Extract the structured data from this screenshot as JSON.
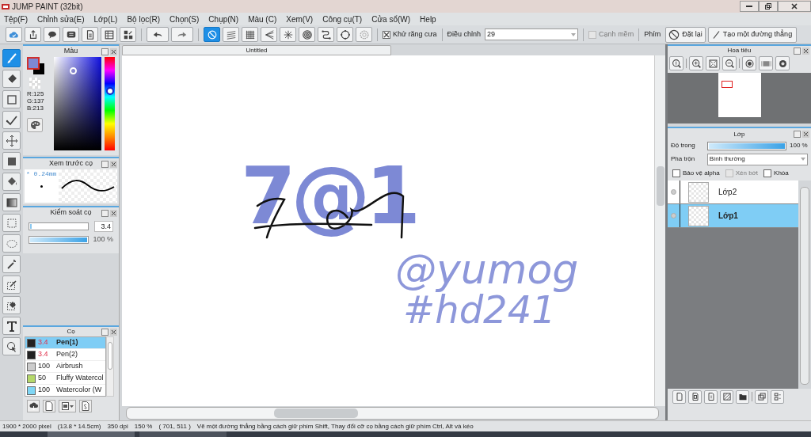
{
  "window": {
    "title": "JUMP PAINT (32bit)"
  },
  "menu": [
    "Tệp(F)",
    "Chỉnh sửa(E)",
    "Lớp(L)",
    "Bộ lọc(R)",
    "Chọn(S)",
    "Chụp(N)",
    "Màu (C)",
    "Xem(V)",
    "Công cụ(T)",
    "Cửa sổ(W)",
    "Help"
  ],
  "toolbar": {
    "file_buttons": [
      {
        "kind": "cloud"
      },
      {
        "kind": "share"
      },
      {
        "kind": "chat"
      },
      {
        "kind": "comment"
      },
      {
        "kind": "page"
      },
      {
        "kind": "sheet"
      },
      {
        "kind": "tiles"
      }
    ],
    "history_buttons": [
      {
        "kind": "undo"
      },
      {
        "kind": "redo"
      }
    ],
    "ruler_buttons": [
      {
        "kind": "none",
        "selected": true
      },
      {
        "kind": "parallel",
        "selected": false
      },
      {
        "kind": "grid",
        "selected": false
      },
      {
        "kind": "perspective",
        "selected": false
      },
      {
        "kind": "radial",
        "selected": false
      },
      {
        "kind": "concentric",
        "selected": false
      },
      {
        "kind": "curve",
        "selected": false
      },
      {
        "kind": "ellipse",
        "selected": false
      },
      {
        "kind": "gear",
        "selected": false
      }
    ],
    "antialias": {
      "label": "Khử răng cưa",
      "checked": true
    },
    "adjust": {
      "label": "Điều chỉnh",
      "value": "29"
    },
    "soft_edge": {
      "label": "Cạnh mềm",
      "checked": false,
      "disabled": true
    },
    "key_label": "Phím",
    "reset_button": "Đặt lại",
    "line_button": "Tạo một đường thẳng"
  },
  "tools": [
    {
      "kind": "brush",
      "selected": true
    },
    {
      "kind": "eraser",
      "selected": false
    },
    {
      "kind": "rect",
      "selected": false
    },
    {
      "kind": "dotline",
      "selected": false
    },
    {
      "kind": "move",
      "selected": false
    },
    {
      "kind": "fill",
      "selected": false
    },
    {
      "kind": "bucket",
      "selected": false
    },
    {
      "kind": "gradient",
      "selected": false
    },
    {
      "kind": "select",
      "selected": false
    },
    {
      "kind": "lasso",
      "selected": false
    },
    {
      "kind": "wand",
      "selected": false
    },
    {
      "kind": "selpen",
      "selected": false
    },
    {
      "kind": "selerase",
      "selected": false
    },
    {
      "kind": "text",
      "selected": false
    },
    {
      "kind": "pointer",
      "selected": false
    }
  ],
  "color_panel": {
    "title": "Màu",
    "readout": [
      "R:125",
      "G:137",
      "B:213"
    ]
  },
  "brush_preview": {
    "title": "Xem trước cọ",
    "size": "* 0.24mm"
  },
  "brush_control": {
    "title": "Kiểm soát cọ",
    "size_level": {
      "level": 0.03
    },
    "size_value": "3.4",
    "opacity": {
      "level": 1
    },
    "opacity_value": "100 %"
  },
  "brushes": {
    "title": "Cọ",
    "items": [
      {
        "color": "#222222",
        "size": "3.4",
        "size_alert": true,
        "name": "Pen(1)",
        "selected": true
      },
      {
        "color": "#222222",
        "size": "3.4",
        "size_alert": true,
        "name": "Pen(2)",
        "selected": false
      },
      {
        "color": "#cccccc",
        "size": "100",
        "size_alert": false,
        "name": "Airbrush",
        "selected": false
      },
      {
        "color": "#b5d86a",
        "size": "50",
        "size_alert": false,
        "name": "Fluffy Watercol",
        "selected": false
      },
      {
        "color": "#7fd6f5",
        "size": "100",
        "size_alert": false,
        "name": "Watercolor (W",
        "selected": false
      }
    ]
  },
  "document": {
    "tab": "Untitled",
    "artwork": [
      "7@1",
      "@yumog",
      "#hd241"
    ]
  },
  "navigator": {
    "title": "Hoa tiêu"
  },
  "layers": {
    "title": "Lớp",
    "opacity_label": "Độ trong",
    "opacity": {
      "level": 1
    },
    "opacity_value": "100 %",
    "blend_label": "Pha trộn",
    "blend": "Bình thường",
    "options": [
      {
        "label": "Bảo vệ alpha",
        "checked": false,
        "disabled": false
      },
      {
        "label": "Xén bớt",
        "checked": false,
        "disabled": true
      },
      {
        "label": "Khóa",
        "checked": false,
        "disabled": false
      }
    ],
    "items": [
      {
        "name": "Lớp2",
        "selected": false
      },
      {
        "name": "Lớp1",
        "selected": true
      }
    ]
  },
  "status_bar": [
    "1900 * 2000 pixel",
    "(13.8 * 14.5cm)",
    "350 dpi",
    "150 %",
    "( 701, 511 )",
    "Vẽ một đường thẳng bằng cách giữ phím Shift, Thay đổi cỡ cọ bằng cách giữ phím Ctrl, Alt và kéo"
  ]
}
